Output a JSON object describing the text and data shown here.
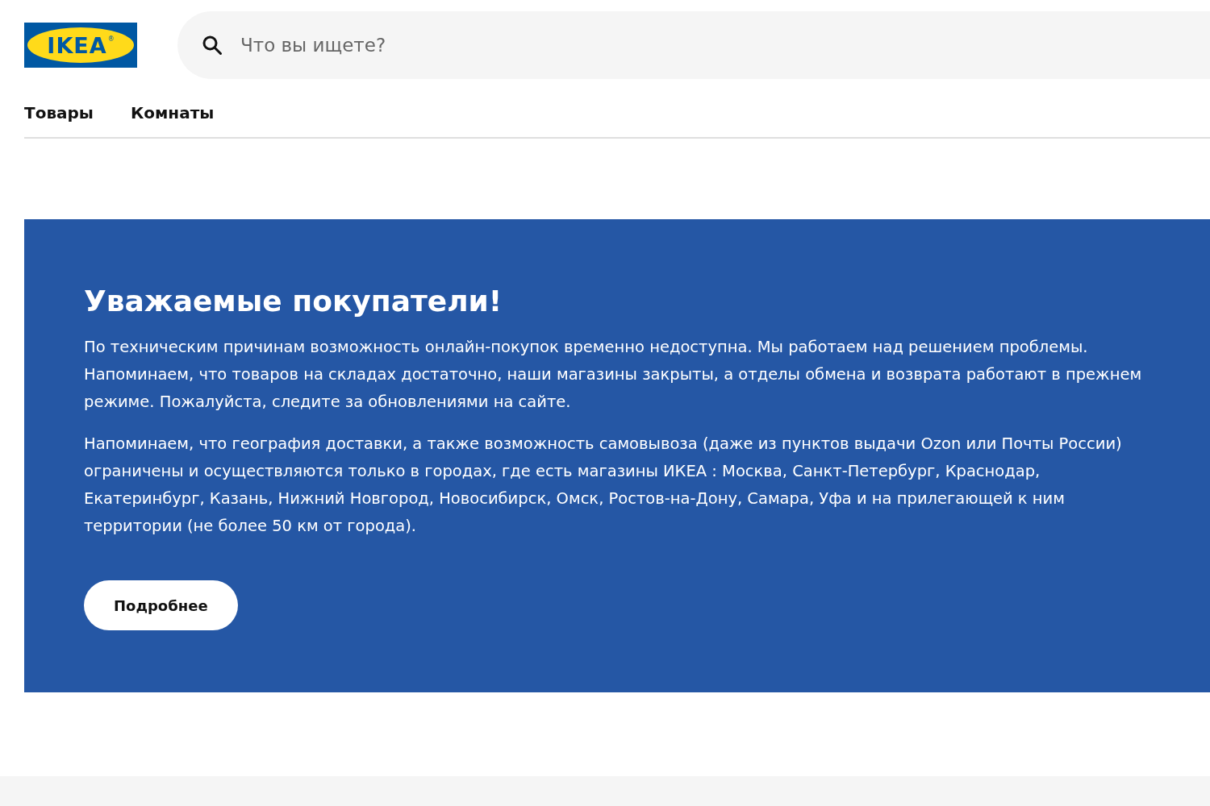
{
  "logo": {
    "text": "IKEA",
    "mark": "®"
  },
  "search": {
    "placeholder": "Что вы ищете?"
  },
  "tabs": [
    {
      "label": "Товары"
    },
    {
      "label": "Комнаты"
    }
  ],
  "banner": {
    "title": "Уважаемые покупатели!",
    "paragraphs": [
      "По техническим причинам возможность онлайн-покупок временно недоступна. Мы работаем над решением проблемы. Напоминаем, что товаров на складах достаточно, наши магазины закрыты, а отделы обмена и возврата работают в прежнем режиме. Пожалуйста, следите за обновлениями на сайте.",
      "Напоминаем, что география доставки, а также возможность самовывоза (даже из пунктов выдачи Ozon или Почты России) ограничены и осуществляются только в городах, где есть магазины ИКЕА : Москва, Санкт-Петербург, Краснодар, Екатеринбург, Казань, Нижний Новгород, Новосибирск, Омск, Ростов-на-Дону, Самара, Уфа и на прилегающей к ним территории (не более 50 км от города)."
    ],
    "button": "Подробнее"
  }
}
